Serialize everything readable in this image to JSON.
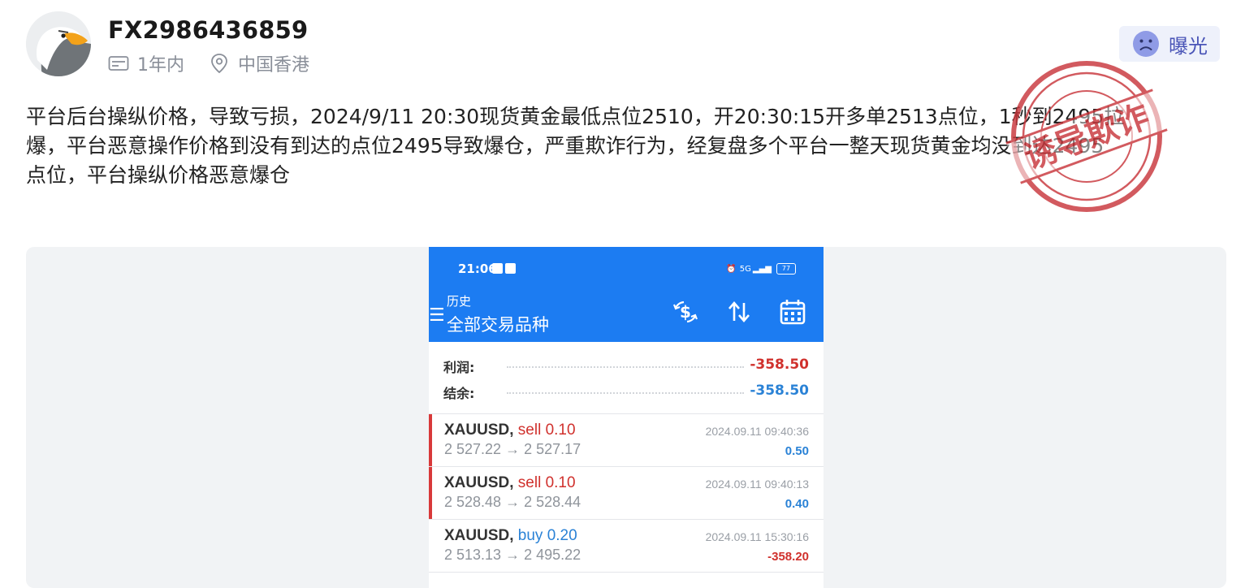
{
  "header": {
    "username": "FX2986436859",
    "account_age": "1年内",
    "location": "中国香港",
    "expose_label": "曝光"
  },
  "post": {
    "lines": [
      "平台后台操纵价格，导致亏损，2024/9/11 20:30现货黄金最低点位2510，开20:30:15开多单2513点位，1秒到2495拉",
      "爆，平台恶意操作价格到没有到达的点位2495导致爆仓，严重欺诈行为，经复盘多个平台一整天现货黄金均没到达2495",
      "点位，平台操纵价格恶意爆仓"
    ]
  },
  "stamp": {
    "text": "诱导欺诈",
    "color": "#c9373c"
  },
  "phone": {
    "time": "21:06",
    "battery": "77",
    "signal": "5G",
    "subtitle": "历史",
    "title": "全部交易品种",
    "summary": [
      {
        "label": "利润:",
        "value": "-358.50",
        "color": "red"
      },
      {
        "label": "结余:",
        "value": "-358.50",
        "color": "blue"
      }
    ],
    "trades": [
      {
        "symbol": "XAUUSD,",
        "side": "sell 0.10",
        "side_color": "red",
        "prices": "2 527.22 → 2 527.17",
        "date": "2024.09.11 09:40:36",
        "pl": "0.50",
        "pl_color": "blue",
        "marked": true
      },
      {
        "symbol": "XAUUSD,",
        "side": "sell 0.10",
        "side_color": "red",
        "prices": "2 528.48 → 2 528.44",
        "date": "2024.09.11 09:40:13",
        "pl": "0.40",
        "pl_color": "blue",
        "marked": true
      },
      {
        "symbol": "XAUUSD,",
        "side": "buy 0.20",
        "side_color": "blue",
        "prices": "2 513.13 → 2 495.22",
        "date": "2024.09.11 15:30:16",
        "pl": "-358.20",
        "pl_color": "red",
        "marked": false
      }
    ]
  },
  "colors": {
    "accent": "#1c7cf2",
    "loss": "#d0312d",
    "profit": "#2a82d6",
    "expose": "#4a55b7"
  }
}
